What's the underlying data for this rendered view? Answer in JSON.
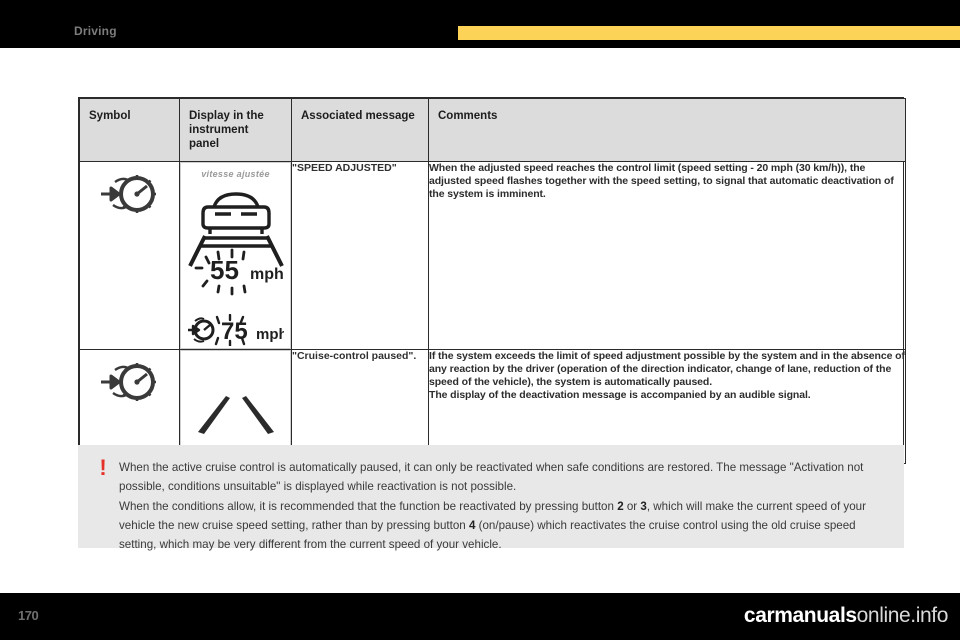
{
  "header": {
    "chapter": "Driving",
    "tab_color": "#fcd257"
  },
  "footer": {
    "page_number": "170",
    "watermark_main": "carmanuals",
    "watermark_dim": "online.info"
  },
  "table": {
    "columns": [
      "Symbol",
      "Display in the instrument panel",
      "Associated message",
      "Comments"
    ],
    "rows": [
      {
        "symbol_icon": "cruise-control-speed-icon",
        "display": {
          "caption": "vitesse ajustée",
          "adjusted_speed_value": "55",
          "adjusted_speed_unit": "mph",
          "set_speed_value": "75",
          "set_speed_unit": "mph",
          "graphic": "car-in-lane-with-flashing-speed"
        },
        "message": "\"SPEED ADJUSTED\"",
        "comments": "When the adjusted speed reaches the control limit (speed setting - 20 mph (30 km/h)), the adjusted speed flashes together with the speed setting, to signal that automatic deactivation of the system is imminent."
      },
      {
        "symbol_icon": "cruise-control-speed-icon",
        "display": {
          "graphic": "lane-markings-only"
        },
        "message": "\"Cruise-control paused\".",
        "comments_lines": [
          "If the system exceeds the limit of speed adjustment possible by the system and in the absence of any reaction by the driver (operation of the direction indicator, change of lane, reduction of the speed of the vehicle), the system is automatically paused.",
          "The display of the deactivation message is accompanied by an audible signal."
        ]
      }
    ]
  },
  "note": {
    "icon": "warning-exclamation-icon",
    "icon_color": "#e4322b",
    "paragraph_1a": "When the active cruise control is automatically paused, it can only be reactivated when safe conditions are restored. The message \"Activation not possible, conditions unsuitable\" is displayed while reactivation is not possible.",
    "paragraph_2a": "When the conditions allow, it is recommended that the function be reactivated by pressing button ",
    "button_a": "2",
    "paragraph_2b": " or ",
    "button_b": "3",
    "paragraph_2c": ", which will make the current speed of your vehicle the new cruise speed setting, rather than by pressing button ",
    "button_c": "4",
    "paragraph_2d": " (on/pause) which reactivates the cruise control using the old cruise speed setting, which may be very different from the current speed of your vehicle."
  }
}
